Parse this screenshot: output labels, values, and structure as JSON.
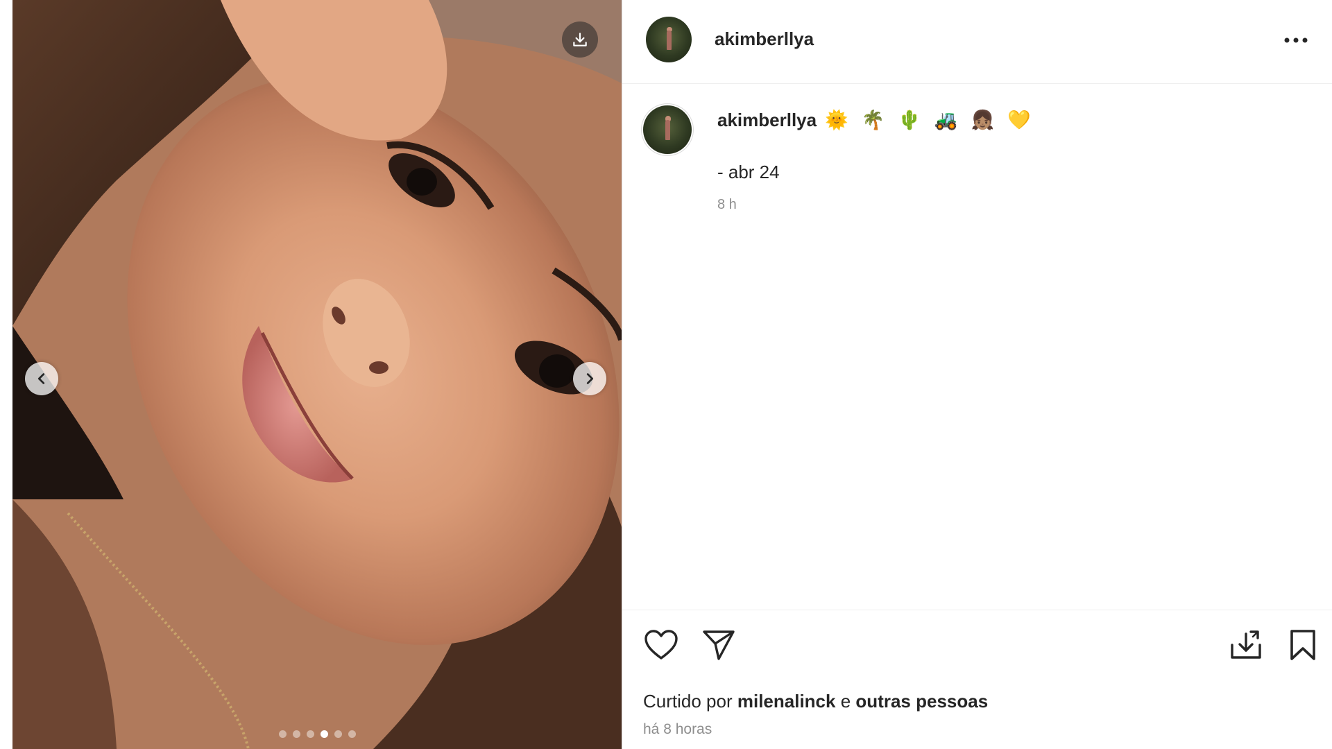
{
  "post": {
    "username": "akimberllya",
    "caption_emojis": [
      "🌞",
      "🌴",
      "🌵",
      "🚜",
      "👧🏽",
      "💛"
    ],
    "caption_text": "- abr 24",
    "caption_time": "8 h",
    "carousel": {
      "total": 6,
      "active_index": 3
    },
    "likes": {
      "prefix": "Curtido por",
      "user": "milenalinck",
      "joiner": "e",
      "others": "outras pessoas"
    },
    "age": "há 8 horas"
  },
  "icons": {
    "download": "download-icon",
    "prev": "chevron-left-icon",
    "next": "chevron-right-icon",
    "more": "more-options-icon",
    "like": "heart-icon",
    "share": "send-icon",
    "save_collection": "save-to-collection-icon",
    "bookmark": "bookmark-icon"
  },
  "colors": {
    "text": "#262626",
    "secondary_text": "#8e8e8e",
    "divider": "#dbdbdb"
  }
}
